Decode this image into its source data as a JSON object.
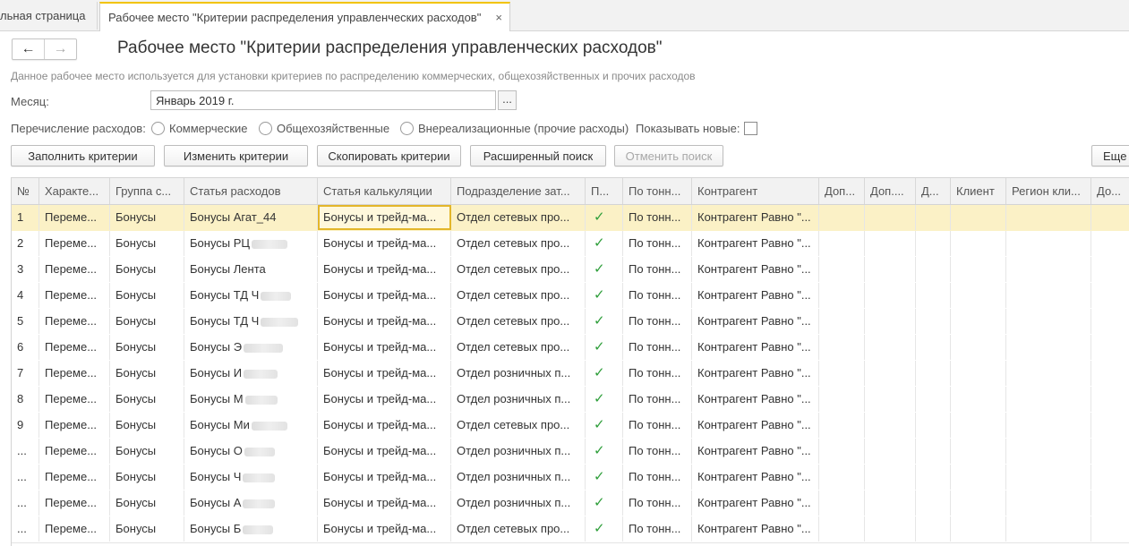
{
  "tabs": {
    "home_label": "льная страница",
    "active_label": "Рабочее место \"Критерии распределения управленческих расходов\"",
    "close_glyph": "×"
  },
  "nav": {
    "back_glyph": "←",
    "forward_glyph": "→"
  },
  "page": {
    "title": "Рабочее место \"Критерии распределения управленческих расходов\"",
    "description": "Данное рабочее место используется для установки критериев по распределению коммерческих, общехозяйственных и прочих расходов"
  },
  "month": {
    "label": "Месяц:",
    "value": "Январь 2019 г.",
    "picker": "..."
  },
  "expenses": {
    "label": "Перечисление расходов:",
    "options": [
      "Коммерческие",
      "Общехозяйственные",
      "Внереализационные (прочие расходы)"
    ],
    "show_new_label": "Показывать новые:",
    "show_new_checked": false
  },
  "buttons": {
    "fill": "Заполнить критерии",
    "change": "Изменить критерии",
    "copy": "Скопировать критерии",
    "advanced_search": "Расширенный поиск",
    "cancel_search": "Отменить поиск",
    "more": "Еще"
  },
  "table": {
    "columns": [
      "№",
      "Характе...",
      "Группа с...",
      "Статья расходов",
      "Статья калькуляции",
      "Подразделение зат...",
      "П...",
      "По тонн...",
      "Контрагент",
      "Доп...",
      "Доп....",
      "Д...",
      "Клиент",
      "Регион кли...",
      "До..."
    ],
    "rows": [
      {
        "num": "1",
        "char": "Переме...",
        "group": "Бонусы",
        "article": "Бонусы Агат_44",
        "calc": "Бонусы и трейд-ма...",
        "dept": "Отдел сетевых про...",
        "p": true,
        "tonn": "По тонн...",
        "contractor": "Контрагент Равно \"..."
      },
      {
        "num": "2",
        "char": "Переме...",
        "group": "Бонусы",
        "article": "Бонусы РЦ",
        "calc": "Бонусы и трейд-ма...",
        "dept": "Отдел сетевых про...",
        "p": true,
        "tonn": "По тонн...",
        "contractor": "Контрагент Равно \"..."
      },
      {
        "num": "3",
        "char": "Переме...",
        "group": "Бонусы",
        "article": "Бонусы Лента",
        "calc": "Бонусы и трейд-ма...",
        "dept": "Отдел сетевых про...",
        "p": true,
        "tonn": "По тонн...",
        "contractor": "Контрагент Равно \"..."
      },
      {
        "num": "4",
        "char": "Переме...",
        "group": "Бонусы",
        "article": "Бонусы ТД Ч",
        "calc": "Бонусы и трейд-ма...",
        "dept": "Отдел сетевых про...",
        "p": true,
        "tonn": "По тонн...",
        "contractor": "Контрагент Равно \"..."
      },
      {
        "num": "5",
        "char": "Переме...",
        "group": "Бонусы",
        "article": "Бонусы ТД Ч",
        "calc": "Бонусы и трейд-ма...",
        "dept": "Отдел сетевых про...",
        "p": true,
        "tonn": "По тонн...",
        "contractor": "Контрагент Равно \"..."
      },
      {
        "num": "6",
        "char": "Переме...",
        "group": "Бонусы",
        "article": "Бонусы Э",
        "calc": "Бонусы и трейд-ма...",
        "dept": "Отдел сетевых про...",
        "p": true,
        "tonn": "По тонн...",
        "contractor": "Контрагент Равно \"..."
      },
      {
        "num": "7",
        "char": "Переме...",
        "group": "Бонусы",
        "article": "Бонусы И",
        "calc": "Бонусы и трейд-ма...",
        "dept": "Отдел розничных п...",
        "p": true,
        "tonn": "По тонн...",
        "contractor": "Контрагент Равно \"..."
      },
      {
        "num": "8",
        "char": "Переме...",
        "group": "Бонусы",
        "article": "Бонусы М",
        "calc": "Бонусы и трейд-ма...",
        "dept": "Отдел розничных п...",
        "p": true,
        "tonn": "По тонн...",
        "contractor": "Контрагент Равно \"..."
      },
      {
        "num": "9",
        "char": "Переме...",
        "group": "Бонусы",
        "article": "Бонусы Ми",
        "calc": "Бонусы и трейд-ма...",
        "dept": "Отдел сетевых про...",
        "p": true,
        "tonn": "По тонн...",
        "contractor": "Контрагент Равно \"..."
      },
      {
        "num": "...",
        "char": "Переме...",
        "group": "Бонусы",
        "article": "Бонусы О",
        "calc": "Бонусы и трейд-ма...",
        "dept": "Отдел розничных п...",
        "p": true,
        "tonn": "По тонн...",
        "contractor": "Контрагент Равно \"..."
      },
      {
        "num": "...",
        "char": "Переме...",
        "group": "Бонусы",
        "article": "Бонусы Ч",
        "calc": "Бонусы и трейд-ма...",
        "dept": "Отдел розничных п...",
        "p": true,
        "tonn": "По тонн...",
        "contractor": "Контрагент Равно \"..."
      },
      {
        "num": "...",
        "char": "Переме...",
        "group": "Бонусы",
        "article": "Бонусы А",
        "calc": "Бонусы и трейд-ма...",
        "dept": "Отдел розничных п...",
        "p": true,
        "tonn": "По тонн...",
        "contractor": "Контрагент Равно \"..."
      },
      {
        "num": "...",
        "char": "Переме...",
        "group": "Бонусы",
        "article": "Бонусы Б",
        "calc": "Бонусы и трейд-ма...",
        "dept": "Отдел сетевых про...",
        "p": true,
        "tonn": "По тонн...",
        "contractor": "Контрагент Равно \"..."
      }
    ],
    "selected_row": 1,
    "check_glyph": "✓"
  },
  "colors": {
    "accent_tab": "#f2c300",
    "selected_row": "#fbf1c6",
    "focus_cell": "#e3b62a",
    "check": "#2e9e3a"
  }
}
